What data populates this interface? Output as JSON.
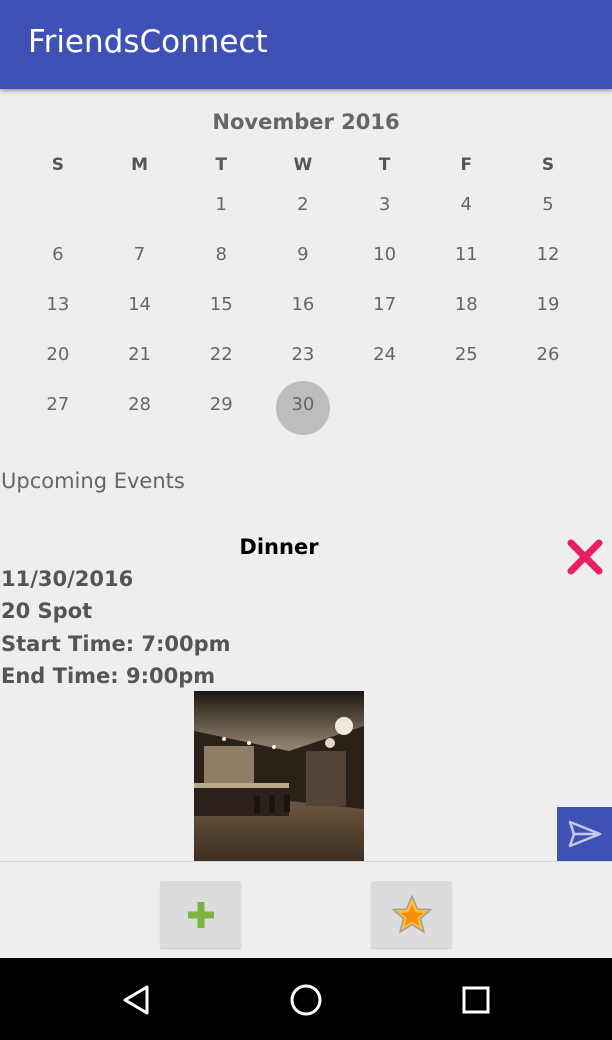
{
  "app": {
    "title": "FriendsConnect"
  },
  "calendar": {
    "month_label": "November 2016",
    "weekdays": [
      "S",
      "M",
      "T",
      "W",
      "T",
      "F",
      "S"
    ],
    "weeks": [
      [
        "",
        "",
        "1",
        "2",
        "3",
        "4",
        "5"
      ],
      [
        "6",
        "7",
        "8",
        "9",
        "10",
        "11",
        "12"
      ],
      [
        "13",
        "14",
        "15",
        "16",
        "17",
        "18",
        "19"
      ],
      [
        "20",
        "21",
        "22",
        "23",
        "24",
        "25",
        "26"
      ],
      [
        "27",
        "28",
        "29",
        "30",
        "",
        "",
        ""
      ]
    ],
    "selected_day": "30"
  },
  "events": {
    "section_label": "Upcoming Events",
    "items": [
      {
        "title": "Dinner",
        "date": "11/30/2016",
        "location": "20 Spot",
        "start": "Start Time: 7:00pm",
        "end": "End Time: 9:00pm"
      }
    ]
  },
  "icons": {
    "delete": "close-icon",
    "send": "send-icon",
    "add": "plus-icon",
    "favorite": "star-icon",
    "back": "back-icon",
    "home": "home-icon",
    "recents": "recents-icon"
  },
  "colors": {
    "primary": "#3f51b5",
    "delete_accent": "#e91e63",
    "add_accent": "#7cb342",
    "star_fill": "#fbc02d",
    "star_center": "#f57c00"
  }
}
